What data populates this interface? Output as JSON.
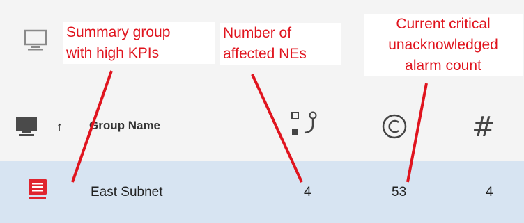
{
  "colors": {
    "annotation": "#e0141e",
    "header_bg": "#f4f4f4",
    "selected_row_bg": "#d7e4f2",
    "group_icon": "#e0242e"
  },
  "icons": {
    "toolbar": "monitor-outline-icon",
    "header": "monitor-filled-icon",
    "sort": "arrow-up-icon",
    "affected_nes": "affected-nes-icon",
    "critical": "copyright-circle-icon",
    "count": "hash-icon",
    "row": "summary-group-icon"
  },
  "table": {
    "header": {
      "sort_indicator": "↑",
      "group_name": "Group Name",
      "count_symbol": "#"
    },
    "rows": [
      {
        "group_name": "East Subnet",
        "affected_nes": "4",
        "critical_unacked": "53",
        "count": "4"
      }
    ]
  },
  "annotations": {
    "summary_group": {
      "line1": "Summary group",
      "line2": "with high KPIs"
    },
    "affected_nes": {
      "line1": "Number of",
      "line2": "affected NEs"
    },
    "critical_alarms": {
      "line1": "Current critical",
      "line2": "unacknowledged",
      "line3": "alarm count"
    }
  }
}
